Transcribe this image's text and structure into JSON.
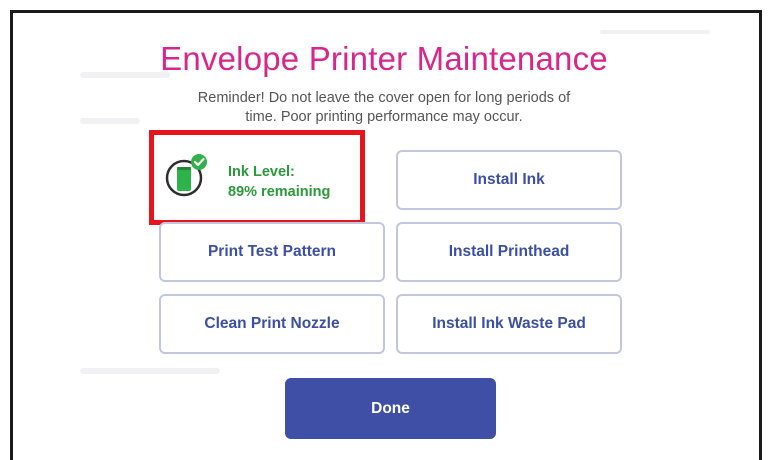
{
  "dialog": {
    "title": "Envelope Printer Maintenance",
    "reminder_line1": "Reminder! Do not leave the cover open for long periods of",
    "reminder_line2": "time. Poor printing performance may occur."
  },
  "ink_status": {
    "label": "Ink Level:",
    "value_text": "89% remaining",
    "level_fraction": 0.89,
    "icon": "ink-cartridge-check-icon",
    "highlight_color": "#e8141c",
    "text_color": "#2a9a3a"
  },
  "buttons": {
    "install_ink": "Install Ink",
    "print_test_pattern": "Print Test Pattern",
    "install_printhead": "Install Printhead",
    "clean_print_nozzle": "Clean Print Nozzle",
    "install_ink_waste_pad": "Install Ink Waste Pad",
    "done": "Done"
  },
  "colors": {
    "title": "#d9268a",
    "button_text": "#3b4fa6",
    "button_border": "#c3c6e0",
    "primary": "#3f4fa5"
  }
}
